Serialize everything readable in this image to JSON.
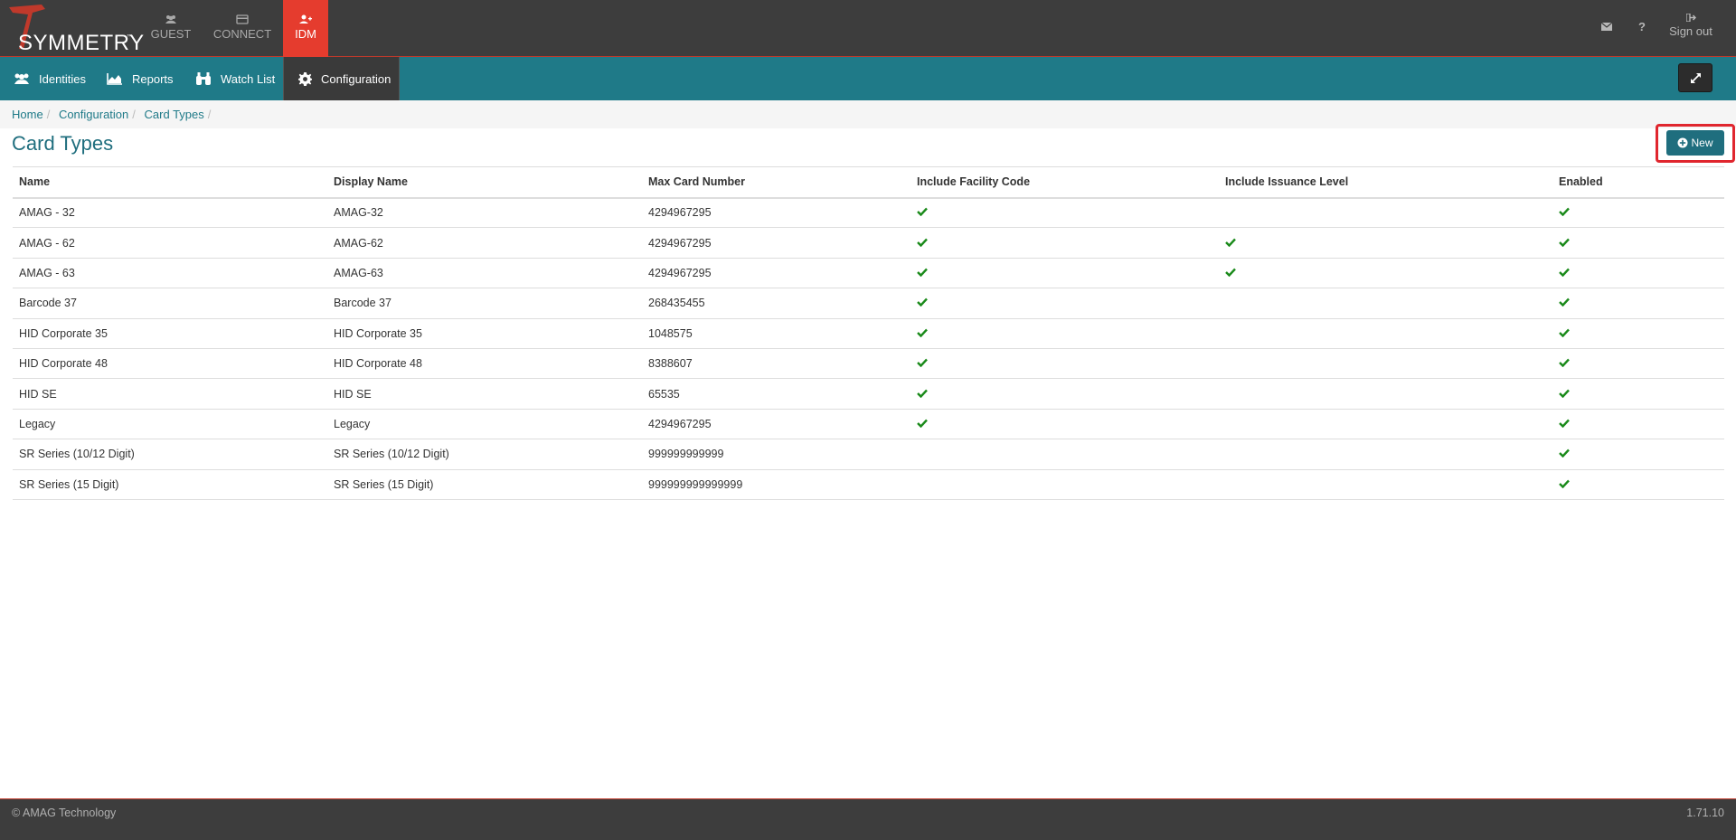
{
  "brand": {
    "name": "SYMMETRY",
    "tm": "™"
  },
  "app_tabs": [
    {
      "label": "GUEST",
      "icon": "users-icon"
    },
    {
      "label": "CONNECT",
      "icon": "card-icon"
    },
    {
      "label": "IDM",
      "icon": "user-plus-icon",
      "active": true
    }
  ],
  "top_right": {
    "signout_label": "Sign out"
  },
  "nav": {
    "items": [
      {
        "label": "Identities",
        "icon": "users-icon"
      },
      {
        "label": "Reports",
        "icon": "area-chart-icon"
      },
      {
        "label": "Watch List",
        "icon": "binoculars-icon"
      },
      {
        "label": "Configuration",
        "icon": "gear-icon",
        "active": true
      }
    ]
  },
  "breadcrumb": [
    "Home",
    "Configuration",
    "Card Types"
  ],
  "page": {
    "title": "Card Types",
    "new_label": "New"
  },
  "table": {
    "headers": [
      "Name",
      "Display Name",
      "Max Card Number",
      "Include Facility Code",
      "Include Issuance Level",
      "Enabled"
    ],
    "rows": [
      {
        "name": "AMAG - 32",
        "display": "AMAG-32",
        "max": "4294967295",
        "facility": true,
        "issuance": false,
        "enabled": true
      },
      {
        "name": "AMAG - 62",
        "display": "AMAG-62",
        "max": "4294967295",
        "facility": true,
        "issuance": true,
        "enabled": true
      },
      {
        "name": "AMAG - 63",
        "display": "AMAG-63",
        "max": "4294967295",
        "facility": true,
        "issuance": true,
        "enabled": true
      },
      {
        "name": "Barcode 37",
        "display": "Barcode 37",
        "max": "268435455",
        "facility": true,
        "issuance": false,
        "enabled": true
      },
      {
        "name": "HID Corporate 35",
        "display": "HID Corporate 35",
        "max": "1048575",
        "facility": true,
        "issuance": false,
        "enabled": true
      },
      {
        "name": "HID Corporate 48",
        "display": "HID Corporate 48",
        "max": "8388607",
        "facility": true,
        "issuance": false,
        "enabled": true
      },
      {
        "name": "HID SE",
        "display": "HID SE",
        "max": "65535",
        "facility": true,
        "issuance": false,
        "enabled": true
      },
      {
        "name": "Legacy",
        "display": "Legacy",
        "max": "4294967295",
        "facility": true,
        "issuance": false,
        "enabled": true
      },
      {
        "name": "SR Series (10/12 Digit)",
        "display": "SR Series (10/12 Digit)",
        "max": "999999999999",
        "facility": false,
        "issuance": false,
        "enabled": true
      },
      {
        "name": "SR Series (15 Digit)",
        "display": "SR Series (15 Digit)",
        "max": "999999999999999",
        "facility": false,
        "issuance": false,
        "enabled": true
      }
    ]
  },
  "footer": {
    "copyright": "© AMAG Technology",
    "version": "1.71.10"
  },
  "colors": {
    "accent": "#1f7a88",
    "brand_red": "#e53c2e",
    "check_green": "#1a8a1a",
    "dark_bar": "#3d3d3d"
  }
}
